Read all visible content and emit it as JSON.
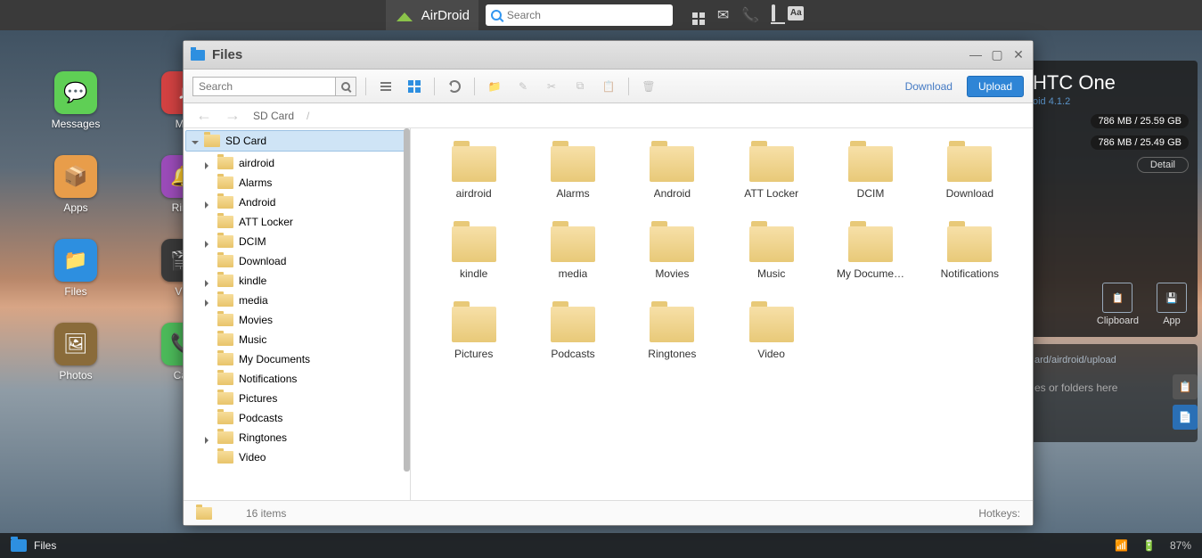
{
  "topbar": {
    "brand": "AirDroid",
    "search_placeholder": "Search"
  },
  "desktop_col1": [
    {
      "label": "Messages",
      "color": "#5fcf55",
      "glyph": "💬"
    },
    {
      "label": "Apps",
      "color": "#e89d4a",
      "glyph": "📦"
    },
    {
      "label": "Files",
      "color": "#2d8fe0",
      "glyph": "📁"
    },
    {
      "label": "Photos",
      "color": "#8a6b3a",
      "glyph": "🖼"
    }
  ],
  "desktop_col2": [
    {
      "label": "Mu",
      "color": "#d44242",
      "glyph": "♪"
    },
    {
      "label": "Ring",
      "color": "#9c4cba",
      "glyph": "🔔"
    },
    {
      "label": "Vid",
      "color": "#3a3a3a",
      "glyph": "🎬"
    },
    {
      "label": "Call",
      "color": "#4cba5a",
      "glyph": "📞"
    }
  ],
  "device": {
    "name": "HTC One",
    "android": "oid 4.1.2",
    "storage1": "786 MB / 25.59 GB",
    "storage2": "786 MB / 25.49 GB",
    "detail_label": "Detail",
    "actions": [
      {
        "label": "Clipboard",
        "glyph": "📋"
      },
      {
        "label": "App",
        "glyph": "💾"
      }
    ]
  },
  "drop": {
    "path": "ard/airdroid/upload",
    "hint": "es or folders here"
  },
  "taskbar": {
    "item": "Files",
    "battery": "87%"
  },
  "window": {
    "title": "Files",
    "search_placeholder": "Search",
    "download_label": "Download",
    "upload_label": "Upload",
    "breadcrumb": "SD Card",
    "status_count": "16 items",
    "hotkeys_label": "Hotkeys:"
  },
  "tree": {
    "root": "SD Card",
    "children": [
      {
        "name": "airdroid",
        "expandable": true
      },
      {
        "name": "Alarms",
        "expandable": false
      },
      {
        "name": "Android",
        "expandable": true
      },
      {
        "name": "ATT Locker",
        "expandable": false
      },
      {
        "name": "DCIM",
        "expandable": true
      },
      {
        "name": "Download",
        "expandable": false
      },
      {
        "name": "kindle",
        "expandable": true
      },
      {
        "name": "media",
        "expandable": true
      },
      {
        "name": "Movies",
        "expandable": false
      },
      {
        "name": "Music",
        "expandable": false
      },
      {
        "name": "My Documents",
        "expandable": false
      },
      {
        "name": "Notifications",
        "expandable": false
      },
      {
        "name": "Pictures",
        "expandable": false
      },
      {
        "name": "Podcasts",
        "expandable": false
      },
      {
        "name": "Ringtones",
        "expandable": true
      },
      {
        "name": "Video",
        "expandable": false
      }
    ]
  },
  "folders": [
    "airdroid",
    "Alarms",
    "Android",
    "ATT Locker",
    "DCIM",
    "Download",
    "kindle",
    "media",
    "Movies",
    "Music",
    "My Documents",
    "Notifications",
    "Pictures",
    "Podcasts",
    "Ringtones",
    "Video"
  ]
}
